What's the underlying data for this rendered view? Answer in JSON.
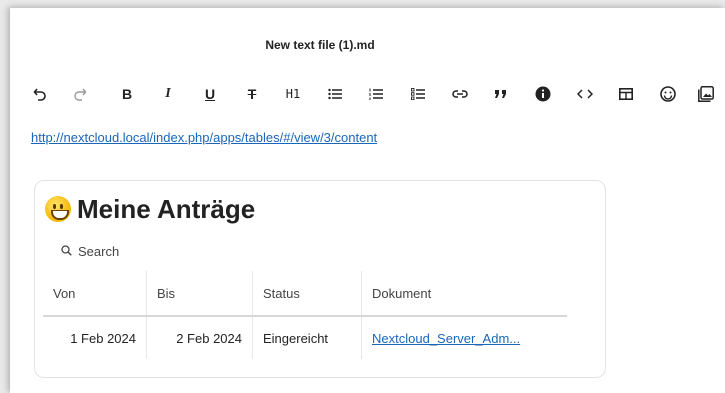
{
  "document": {
    "title": "New text file (1).md"
  },
  "toolbar": {
    "items": [
      {
        "icon": "undo-icon"
      },
      {
        "icon": "redo-icon"
      },
      {
        "icon": "bold-icon",
        "label": "B"
      },
      {
        "icon": "italic-icon",
        "label": "I"
      },
      {
        "icon": "underline-icon",
        "label": "U"
      },
      {
        "icon": "strikethrough-icon",
        "label": "T"
      },
      {
        "icon": "heading-icon",
        "label": "H1"
      },
      {
        "icon": "bullet-list-icon"
      },
      {
        "icon": "numbered-list-icon"
      },
      {
        "icon": "checklist-icon"
      },
      {
        "icon": "link-icon"
      },
      {
        "icon": "quote-icon"
      },
      {
        "icon": "info-icon"
      },
      {
        "icon": "code-icon"
      },
      {
        "icon": "table-icon"
      },
      {
        "icon": "emoji-icon"
      },
      {
        "icon": "image-icon"
      }
    ]
  },
  "content": {
    "link_text": "http://nextcloud.local/index.php/apps/tables/#/view/3/content"
  },
  "table_view": {
    "emoji": "grinning-face-emoji",
    "title": "Meine Anträge",
    "search_label": "Search",
    "columns": [
      "Von",
      "Bis",
      "Status",
      "Dokument"
    ],
    "rows": [
      {
        "von": "1 Feb 2024",
        "bis": "2 Feb 2024",
        "status": "Eingereicht",
        "dokument": "Nextcloud_Server_Adm..."
      }
    ]
  },
  "colors": {
    "link": "#1a66b8",
    "background": "#ffffff"
  }
}
